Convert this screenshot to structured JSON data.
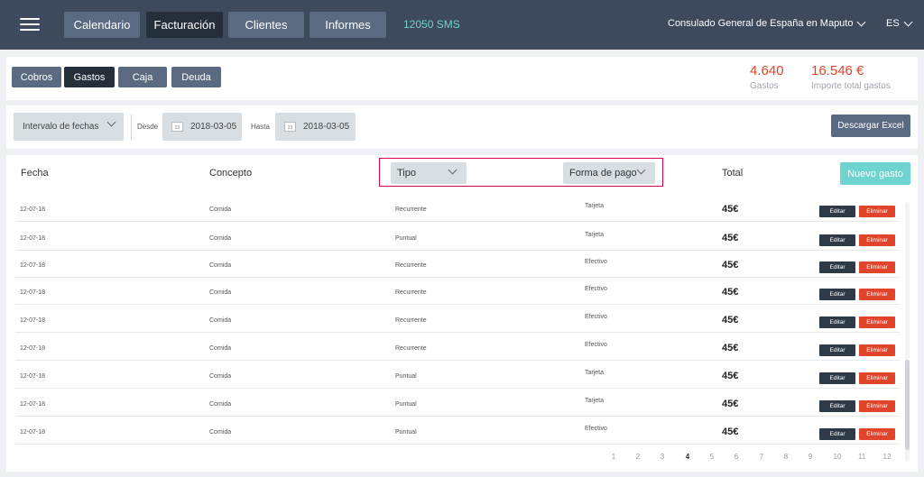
{
  "nav": {
    "items": [
      {
        "label": "Calendario",
        "active": false
      },
      {
        "label": "Facturación",
        "active": true
      },
      {
        "label": "Clientes",
        "active": false
      },
      {
        "label": "Informes",
        "active": false
      }
    ],
    "sms": "12050 SMS",
    "office": "Consulado General de España en Maputo",
    "language": "ES"
  },
  "tabs": [
    {
      "label": "Cobros",
      "active": false
    },
    {
      "label": "Gastos",
      "active": true
    },
    {
      "label": "Caja",
      "active": false
    },
    {
      "label": "Deuda",
      "active": false
    }
  ],
  "stats": {
    "count_value": "4.640",
    "count_label": "Gastos",
    "total_value": "16.546 €",
    "total_label": "Importe total gastos"
  },
  "filters": {
    "interval": "Intervalo de fechas",
    "from_label": "Desde",
    "from_icon": "23",
    "from_date": "2018-03-05",
    "to_label": "Hasta",
    "to_icon": "23",
    "to_date": "2018-03-05",
    "excel": "Descargar Excel"
  },
  "table": {
    "headers": {
      "fecha": "Fecha",
      "concepto": "Concepto",
      "tipo": "Tipo",
      "forma": "Forma de pago",
      "total": "Total"
    },
    "new_button": "Nuevo gasto",
    "edit_label": "Editar",
    "delete_label": "Eliminar",
    "rows": [
      {
        "fecha": "12-07-18",
        "concepto": "Comida",
        "tipo": "Recurrente",
        "forma": "Tarjeta",
        "total": "45€"
      },
      {
        "fecha": "12-07-18",
        "concepto": "Comida",
        "tipo": "Puntual",
        "forma": "Tarjeta",
        "total": "45€"
      },
      {
        "fecha": "12-07-18",
        "concepto": "Comida",
        "tipo": "Recurrente",
        "forma": "Efectivo",
        "total": "45€"
      },
      {
        "fecha": "12-07-18",
        "concepto": "Comida",
        "tipo": "Recurrente",
        "forma": "Efectivo",
        "total": "45€"
      },
      {
        "fecha": "12-07-18",
        "concepto": "Comida",
        "tipo": "Recurrente",
        "forma": "Efectivo",
        "total": "45€"
      },
      {
        "fecha": "12-07-18",
        "concepto": "Comida",
        "tipo": "Recurrente",
        "forma": "Efectivo",
        "total": "45€"
      },
      {
        "fecha": "12-07-18",
        "concepto": "Comida",
        "tipo": "Puntual",
        "forma": "Tarjeta",
        "total": "45€"
      },
      {
        "fecha": "12-07-18",
        "concepto": "Comida",
        "tipo": "Puntual",
        "forma": "Tarjeta",
        "total": "45€"
      },
      {
        "fecha": "12-07-18",
        "concepto": "Comida",
        "tipo": "Puntual",
        "forma": "Efectivo",
        "total": "45€"
      }
    ]
  },
  "pagination": {
    "pages": [
      "1",
      "2",
      "3",
      "4",
      "5",
      "6",
      "7",
      "8",
      "9",
      "10",
      "11",
      "12"
    ],
    "current": "4"
  }
}
